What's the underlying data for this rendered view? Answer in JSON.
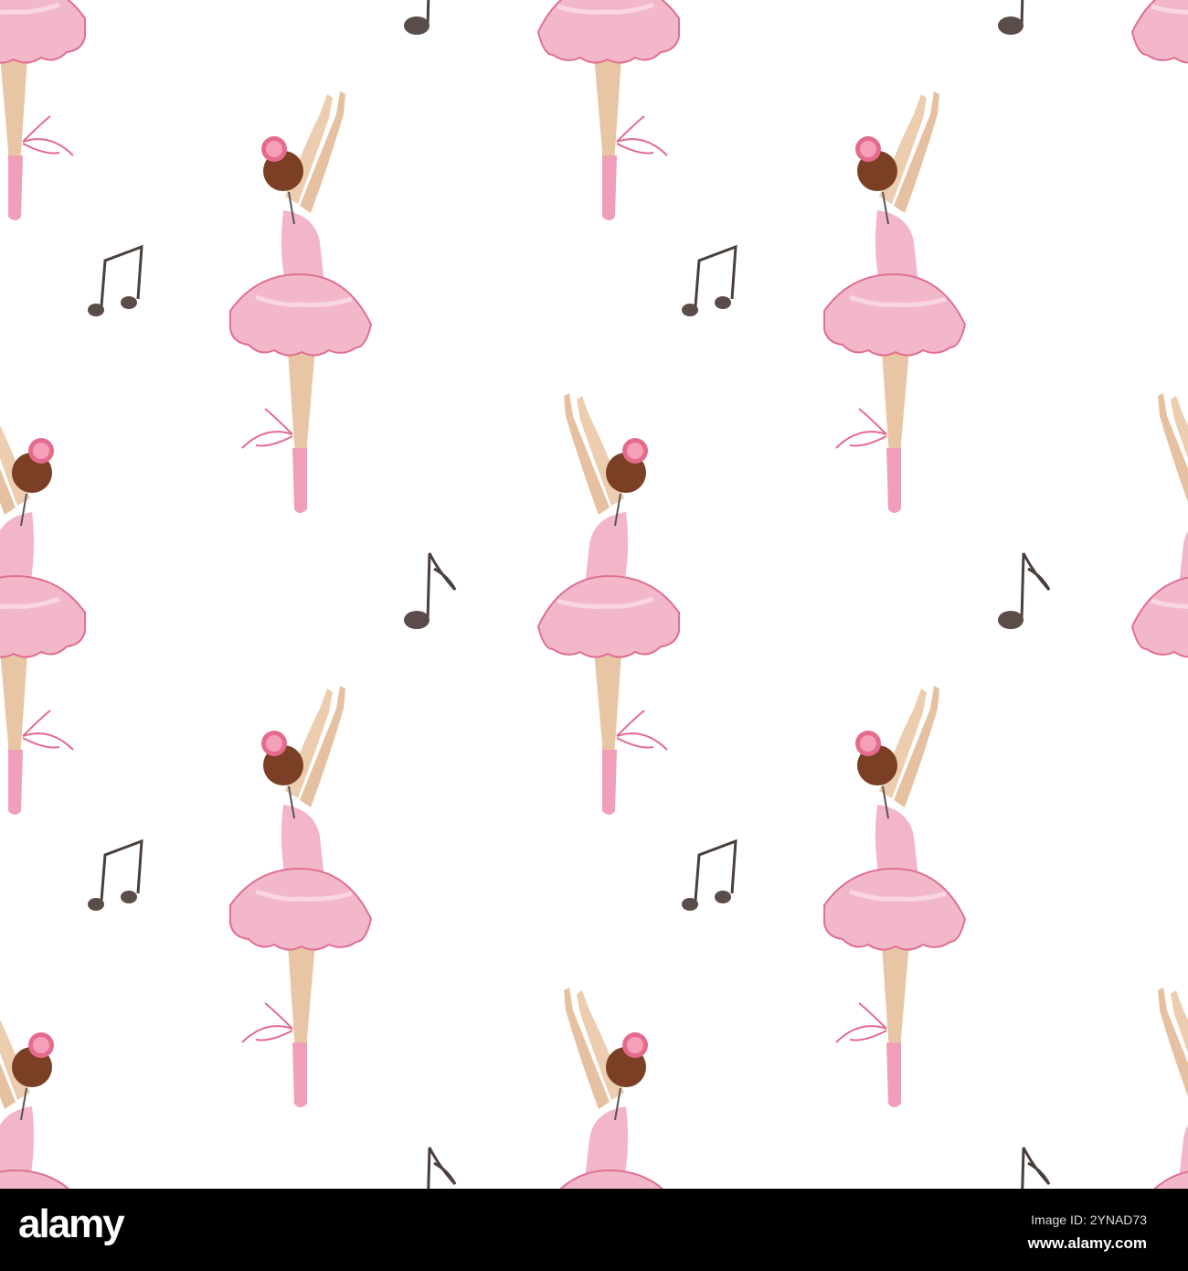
{
  "watermark": {
    "brand": "alamy",
    "image_id": "Image ID: 2YNAD73",
    "site": "www.alamy.com"
  },
  "colors": {
    "tutu": "#f2b8c9",
    "tutu_edge": "#e0708f",
    "skin": "#e9c8a8",
    "hair": "#7a3f25",
    "note": "#5a4c48"
  }
}
